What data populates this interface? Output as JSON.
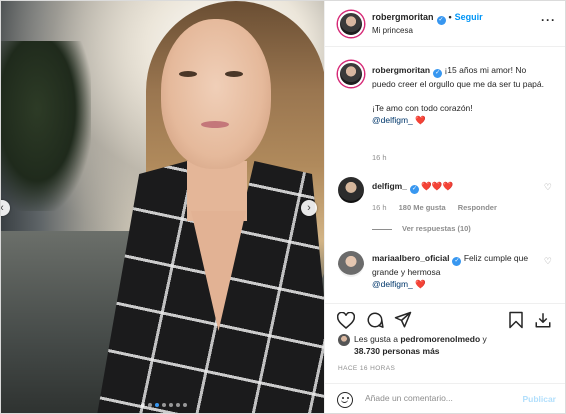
{
  "post": {
    "author": "robergmoritan",
    "follow_label": "Seguir",
    "location": "Mi princesa",
    "more": "···"
  },
  "caption": {
    "user": "robergmoritan",
    "line1": "¡15 años mi amor! No puedo creer el orgullo que me da ser tu papá.",
    "line2": "¡Te amo con todo corazón!",
    "mention": "@delfigm_",
    "emoji": "❤️",
    "time": "16 h"
  },
  "comments": [
    {
      "user": "delfigm_",
      "text": "❤️❤️❤️",
      "time": "16 h",
      "likes": "180 Me gusta",
      "reply": "Responder",
      "view_replies": "Ver respuestas (10)"
    },
    {
      "user": "mariaalbero_oficial",
      "text": "Feliz cumple que grande y hermosa",
      "mention": "@delfigm_",
      "emoji": "❤️"
    }
  ],
  "likes": {
    "prefix": "Les gusta a",
    "user": "pedromorenolmedo",
    "connector": "y",
    "others": "38.730 personas más"
  },
  "timestamp": "HACE 16 HORAS",
  "add_comment": {
    "placeholder": "Añade un comentario...",
    "publish": "Publicar"
  },
  "icons": [
    "heart-icon",
    "comment-icon",
    "share-icon",
    "bookmark-icon",
    "download-icon",
    "emoji-icon",
    "verified-icon"
  ],
  "colors": {
    "link": "#0095f6",
    "mention": "#00376b",
    "heart": "#ed4956",
    "muted": "#8e8e8e",
    "publish_disabled": "#b2dffc"
  },
  "carousel": {
    "slide": 3,
    "total": 7
  }
}
